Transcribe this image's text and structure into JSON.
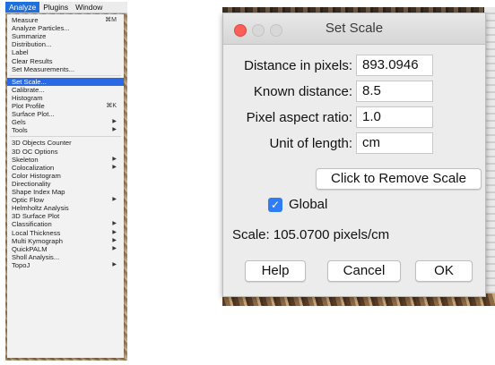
{
  "menubar": {
    "items": [
      "Analyze",
      "Plugins",
      "Window"
    ]
  },
  "menu": {
    "group1": [
      {
        "label": "Measure",
        "shortcut": "⌘M"
      },
      {
        "label": "Analyze Particles..."
      },
      {
        "label": "Summarize"
      },
      {
        "label": "Distribution..."
      },
      {
        "label": "Label"
      },
      {
        "label": "Clear Results"
      },
      {
        "label": "Set Measurements..."
      }
    ],
    "group2": [
      {
        "label": "Set Scale...",
        "selected": true
      },
      {
        "label": "Calibrate..."
      },
      {
        "label": "Histogram"
      },
      {
        "label": "Plot Profile",
        "shortcut": "⌘K"
      },
      {
        "label": "Surface Plot..."
      },
      {
        "label": "Gels",
        "submenu": true
      },
      {
        "label": "Tools",
        "submenu": true
      }
    ],
    "group3": [
      {
        "label": "3D Objects Counter"
      },
      {
        "label": "3D OC Options"
      },
      {
        "label": "Skeleton",
        "submenu": true
      },
      {
        "label": "Colocalization",
        "submenu": true
      },
      {
        "label": "Color Histogram"
      },
      {
        "label": "Directionality"
      },
      {
        "label": "Shape Index Map"
      },
      {
        "label": "Optic Flow",
        "submenu": true
      },
      {
        "label": "Helmholtz Analysis"
      },
      {
        "label": "3D Surface Plot"
      },
      {
        "label": "Classification",
        "submenu": true
      },
      {
        "label": "Local Thickness",
        "submenu": true
      },
      {
        "label": "Multi Kymograph",
        "submenu": true
      },
      {
        "label": "QuickPALM",
        "submenu": true
      },
      {
        "label": "Sholl Analysis..."
      },
      {
        "label": "TopoJ",
        "submenu": true
      }
    ]
  },
  "dialog": {
    "title": "Set Scale",
    "fields": [
      {
        "label": "Distance in pixels:",
        "value": "893.0946"
      },
      {
        "label": "Known distance:",
        "value": "8.5"
      },
      {
        "label": "Pixel aspect ratio:",
        "value": "1.0"
      },
      {
        "label": "Unit of length:",
        "value": "cm"
      }
    ],
    "remove_scale_button": "Click to Remove Scale",
    "global_label": "Global",
    "global_checked": true,
    "scale_text": "Scale: 105.0700 pixels/cm",
    "buttons": {
      "help": "Help",
      "cancel": "Cancel",
      "ok": "OK"
    }
  },
  "colors": {
    "selection": "#2a69e4",
    "checkbox": "#2f7cf6",
    "close_button": "#fc5f57"
  }
}
